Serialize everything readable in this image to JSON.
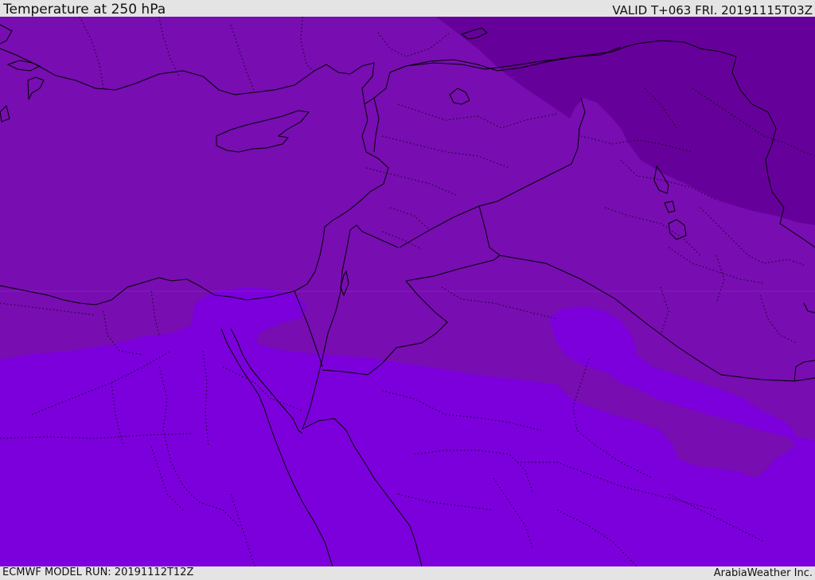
{
  "header": {
    "title": "Temperature at 250 hPa",
    "valid_time": "VALID T+063 FRI. 20191115T03Z"
  },
  "footer": {
    "model_run": "ECMWF MODEL RUN: 20191112T12Z",
    "credit": "ArabiaWeather Inc."
  },
  "colors": {
    "band_warm": "#7c00dc",
    "band_mid": "#780db2",
    "band_cold": "#66009a",
    "border_line": "#000000",
    "frame_bg": "#e4e4e4"
  }
}
